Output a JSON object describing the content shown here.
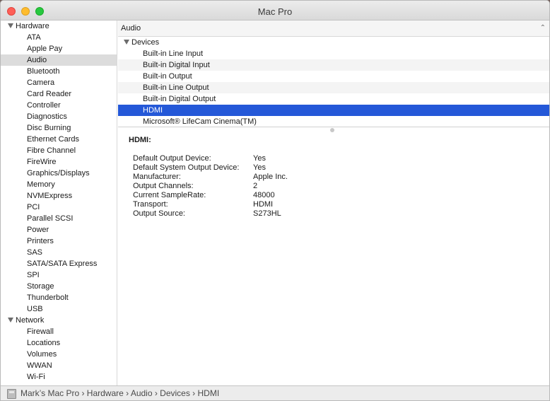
{
  "window": {
    "title": "Mac Pro"
  },
  "sidebar": {
    "hardware_label": "Hardware",
    "hardware_items": [
      "ATA",
      "Apple Pay",
      "Audio",
      "Bluetooth",
      "Camera",
      "Card Reader",
      "Controller",
      "Diagnostics",
      "Disc Burning",
      "Ethernet Cards",
      "Fibre Channel",
      "FireWire",
      "Graphics/Displays",
      "Memory",
      "NVMExpress",
      "PCI",
      "Parallel SCSI",
      "Power",
      "Printers",
      "SAS",
      "SATA/SATA Express",
      "SPI",
      "Storage",
      "Thunderbolt",
      "USB"
    ],
    "selected_item": "Audio",
    "network_label": "Network",
    "network_items": [
      "Firewall",
      "Locations",
      "Volumes",
      "WWAN",
      "Wi-Fi"
    ]
  },
  "main": {
    "header": "Audio",
    "devices_label": "Devices",
    "devices": [
      "Built-in Line Input",
      "Built-in Digital Input",
      "Built-in Output",
      "Built-in Line Output",
      "Built-in Digital Output",
      "HDMI",
      "Microsoft® LifeCam Cinema(TM)"
    ],
    "selected_device": "HDMI",
    "detail_title": "HDMI:",
    "properties": [
      {
        "key": "Default Output Device:",
        "value": "Yes"
      },
      {
        "key": "Default System Output Device:",
        "value": "Yes"
      },
      {
        "key": "Manufacturer:",
        "value": "Apple Inc."
      },
      {
        "key": "Output Channels:",
        "value": "2"
      },
      {
        "key": "Current SampleRate:",
        "value": "48000"
      },
      {
        "key": "Transport:",
        "value": "HDMI"
      },
      {
        "key": "Output Source:",
        "value": "S273HL"
      }
    ]
  },
  "statusbar": {
    "path": "Mark’s Mac Pro › Hardware › Audio › Devices › HDMI"
  },
  "icons": {
    "status_icon": "computer-icon",
    "collapse": "chevron-up-icon",
    "disclosure": "disclosure-triangle-icon"
  }
}
